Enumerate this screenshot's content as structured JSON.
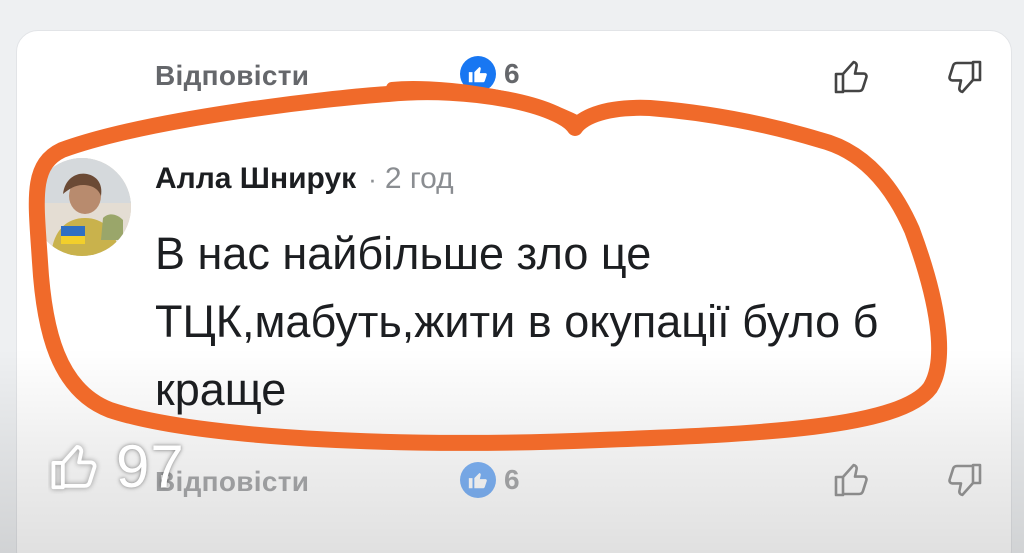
{
  "top_actions": {
    "reply_label": "Відповісти",
    "like_count": "6",
    "like_icon": "thumbs-up-icon",
    "upvote_icon": "thumbs-up-outline-icon",
    "downvote_icon": "thumbs-down-outline-icon"
  },
  "comment": {
    "author": "Алла Шнирук",
    "separator": "·",
    "time_ago": "2 год",
    "text": "В нас найбільше зло це ТЦК,мабуть,жити в окупації було б краще"
  },
  "bottom_actions": {
    "reply_label": "Відповісти",
    "like_count": "6"
  },
  "overlay": {
    "reaction_count": "97",
    "icon": "thumbs-up-outline-icon"
  },
  "colors": {
    "facebook_blue": "#1877f2",
    "annotation_orange": "#f06a2a",
    "meta_gray": "#65676b"
  }
}
